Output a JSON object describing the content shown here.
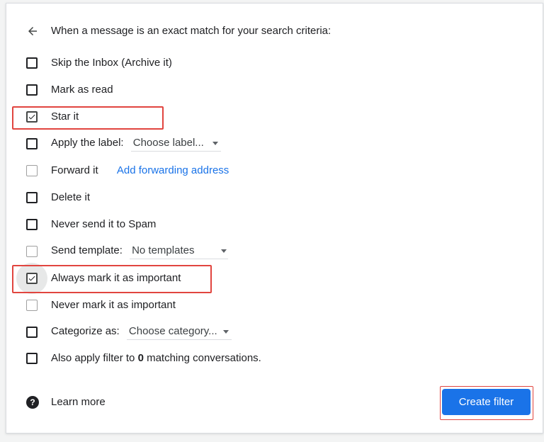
{
  "header": {
    "title": "When a message is an exact match for your search criteria:"
  },
  "options": {
    "skip_inbox": "Skip the Inbox (Archive it)",
    "mark_read": "Mark as read",
    "star": "Star it",
    "apply_label": "Apply the label:",
    "label_placeholder": "Choose label...",
    "forward": "Forward it",
    "forward_link": "Add forwarding address",
    "delete": "Delete it",
    "never_spam": "Never send it to Spam",
    "send_template": "Send template:",
    "template_value": "No templates",
    "always_important": "Always mark it as important",
    "never_important": "Never mark it as important",
    "categorize": "Categorize as:",
    "category_placeholder": "Choose category...",
    "also_apply_prefix": "Also apply filter to",
    "also_apply_count": "0",
    "also_apply_suffix": "matching conversations."
  },
  "state": {
    "star_checked": true,
    "always_important_checked": true
  },
  "footer": {
    "learn_more": "Learn more",
    "create_filter": "Create filter"
  },
  "colors": {
    "accent": "#1a73e8",
    "highlight": "#e1453f"
  },
  "icons": {
    "back": "arrow-left-icon",
    "check": "checkmark-icon",
    "help": "help-circle-icon",
    "dropdown": "caret-down-icon"
  }
}
